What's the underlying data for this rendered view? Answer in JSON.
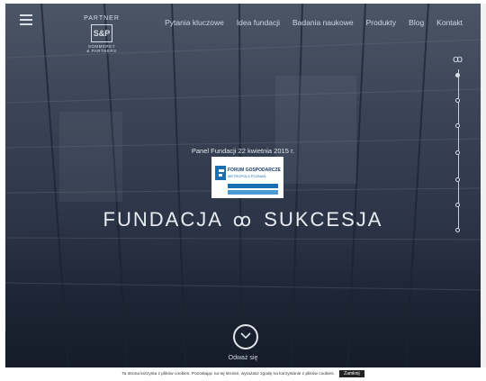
{
  "header": {
    "menu_icon": "hamburger-icon",
    "logo": {
      "top": "PARTNER",
      "mark": "S&P",
      "line1": "SOMMEREY",
      "line2": "& PARTNERS"
    },
    "nav": [
      "Pytania kluczowe",
      "Idea fundacji",
      "Badania naukowe",
      "Produkty",
      "Blog",
      "Kontakt"
    ]
  },
  "side_nav": {
    "dot_count": 7,
    "active_index": 0,
    "top_icon": "sukcesja-symbol-icon"
  },
  "hero": {
    "panel_text": "Panel Fundacji 22 kwietnia 2015 r.",
    "badge": {
      "line1": "FORUM GOSPODARCZE",
      "line2": "METROPOLII POZNAŃ"
    },
    "title_left": "FUNDACJA",
    "title_right": "SUKCESJA",
    "scroll_label": "Odważ się"
  },
  "cookie": {
    "text": "Ta strona korzysta z plików cookies. Pozostając na tej stronie, wyrażasz zgodę na korzystanie z plików cookies.",
    "button": "Zamknij"
  },
  "colors": {
    "bg_top": "#4a5566",
    "bg_bottom": "#151b28",
    "accent_blue": "#1b6fb5"
  }
}
